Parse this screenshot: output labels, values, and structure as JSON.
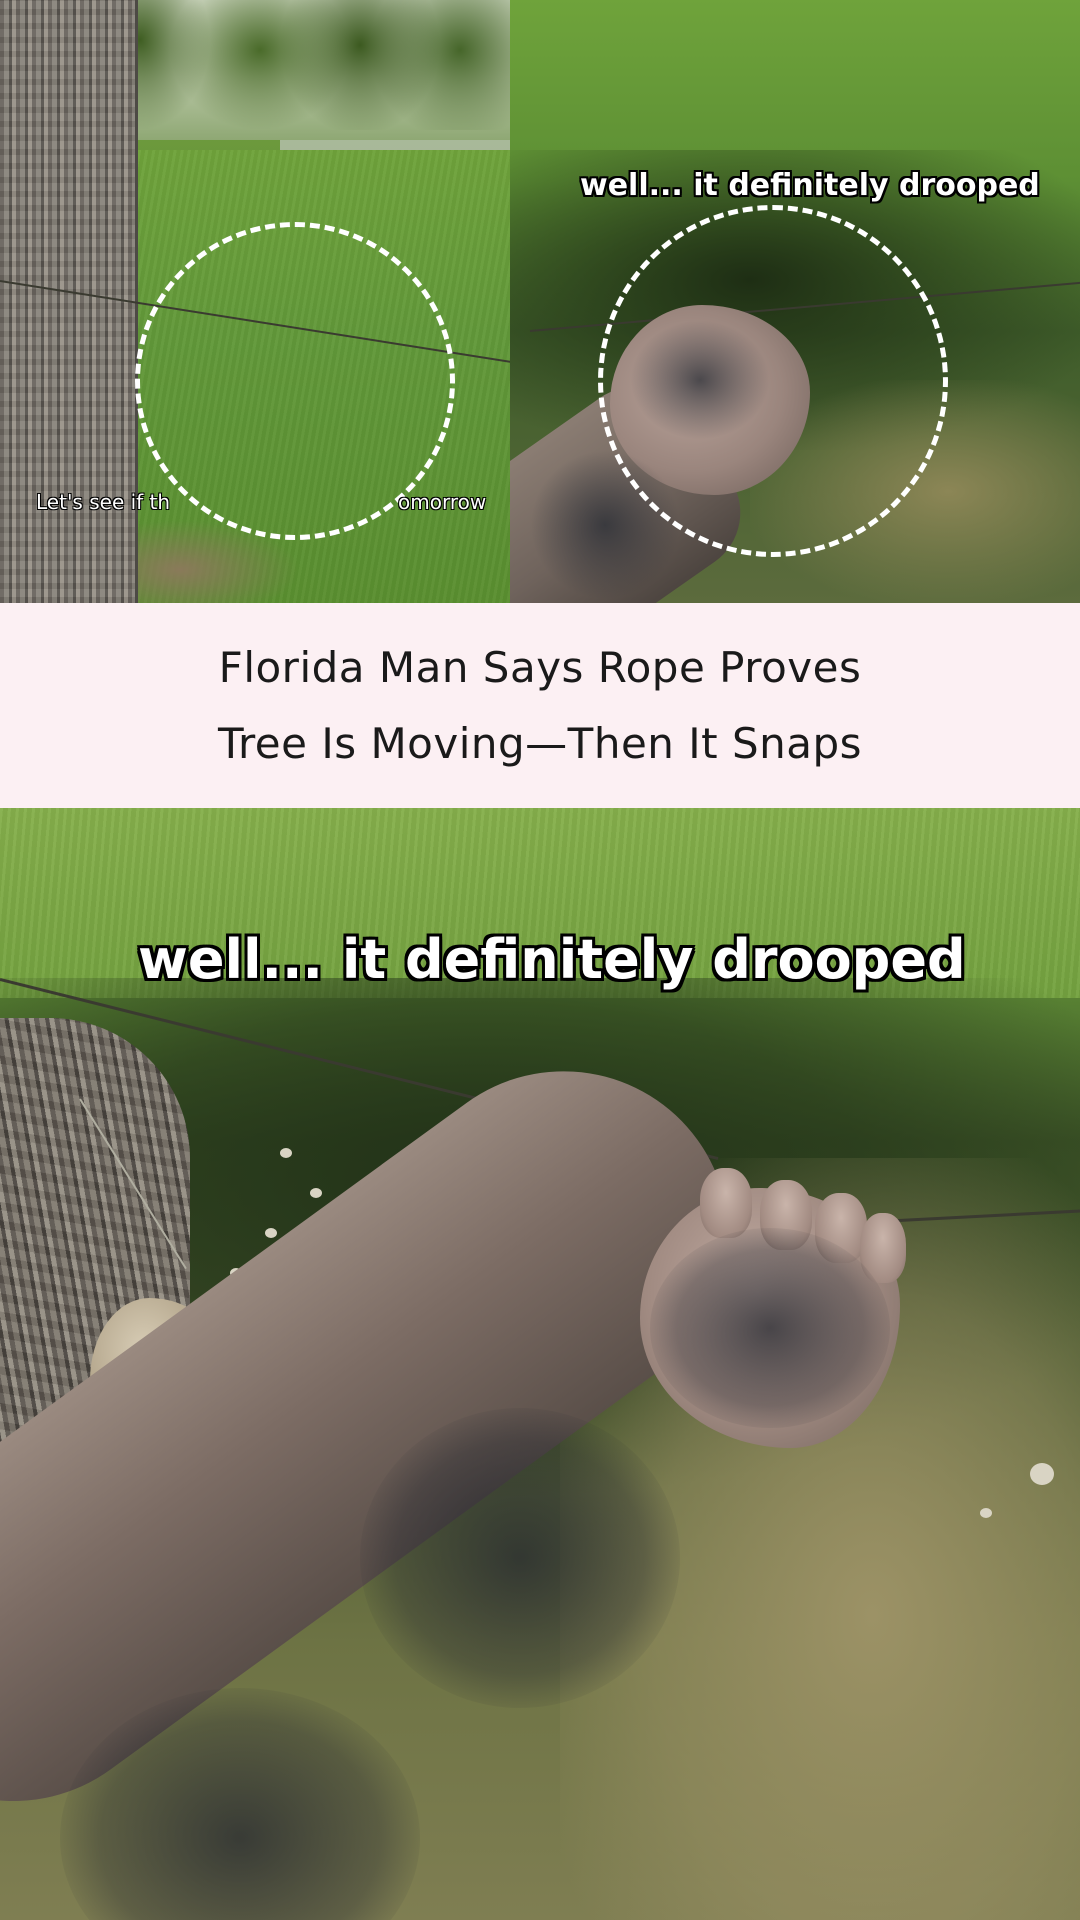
{
  "collage": {
    "left_panel": {
      "caption_left": "Let's see if th",
      "caption_right": "omorrow"
    },
    "right_panel": {
      "caption": "well... it definitely drooped"
    }
  },
  "headline": {
    "line1": "Florida Man Says Rope Proves",
    "line2": "Tree Is Moving—Then It Snaps"
  },
  "bottom_photo": {
    "caption": "well... it definitely drooped"
  },
  "colors": {
    "headline_band_bg": "#fcf0f3",
    "headline_text": "#1a1a1a",
    "caption_fill": "#ffffff",
    "caption_outline": "#000000",
    "dashed_circle": "#ffffff"
  }
}
